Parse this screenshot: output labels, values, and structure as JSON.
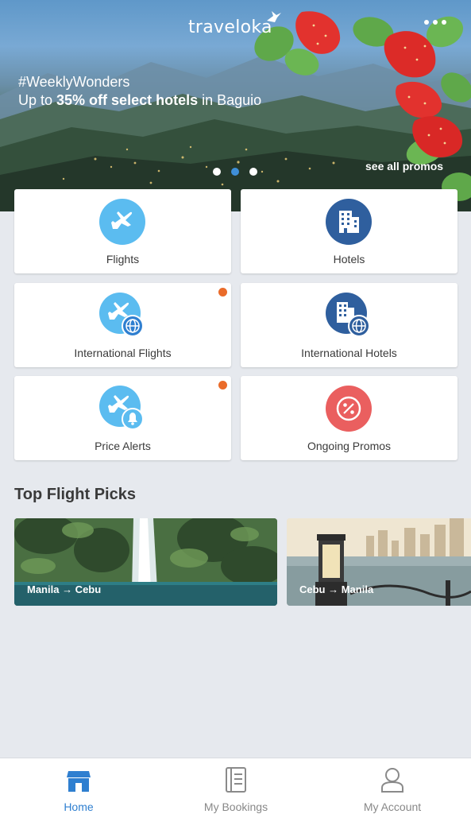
{
  "colors": {
    "accent": "#2f7fd0",
    "flight_icon_bg": "#5bbcf0",
    "hotel_icon_bg": "#2f5f9e",
    "promo_icon_bg": "#ea5f5f",
    "badge": "#ea6b2a"
  },
  "header": {
    "brand": "traveloka",
    "more_icon": "more-dots-icon"
  },
  "promo_banner": {
    "hashtag": "#WeeklyWonders",
    "headline_prefix": "Up to ",
    "headline_bold": "35% off select hotels",
    "headline_suffix": " in Baguio",
    "see_all": "see all promos",
    "slide_count": 3,
    "active_slide": 2
  },
  "products": [
    {
      "label": "Flights",
      "icon": "airplane-icon",
      "has_badge": false
    },
    {
      "label": "Hotels",
      "icon": "building-icon",
      "has_badge": false
    },
    {
      "label": "International Flights",
      "icon": "airplane-globe-icon",
      "has_badge": true
    },
    {
      "label": "International Hotels",
      "icon": "building-globe-icon",
      "has_badge": false
    },
    {
      "label": "Price Alerts",
      "icon": "airplane-bell-icon",
      "has_badge": true
    },
    {
      "label": "Ongoing Promos",
      "icon": "percent-badge-icon",
      "has_badge": false
    }
  ],
  "top_flight_picks": {
    "title": "Top Flight Picks",
    "items": [
      {
        "route": "Manila → Cebu"
      },
      {
        "route": "Cebu → Manila"
      }
    ]
  },
  "bottom_nav": {
    "items": [
      {
        "label": "Home",
        "icon": "home-store-icon",
        "active": true
      },
      {
        "label": "My Bookings",
        "icon": "bookings-icon",
        "active": false
      },
      {
        "label": "My Account",
        "icon": "account-icon",
        "active": false
      }
    ]
  }
}
